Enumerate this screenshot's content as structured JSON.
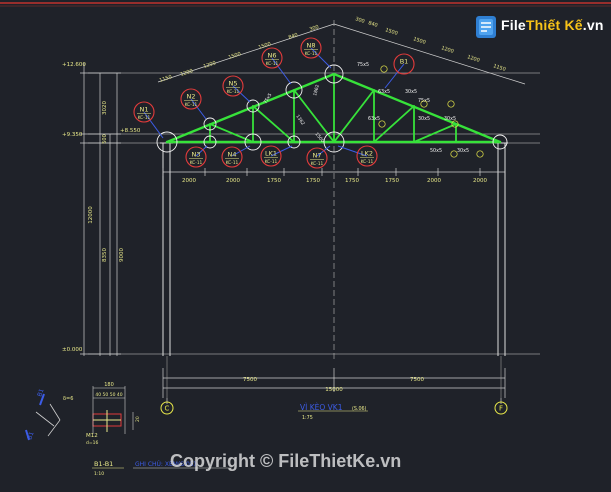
{
  "colors": {
    "background": "#1f2229",
    "truss": "#37e23a",
    "grid": "#bfbfbf",
    "dim_text": "#e9e98a",
    "node_circle": "#e13b3b",
    "node_marker": "#ffffff",
    "member_tag": "#3c5ce6",
    "axis_bubble": "#e8e84a",
    "border": "#c0322e"
  },
  "watermark": {
    "logo_part1": "File",
    "logo_part2": "Thiết Kế",
    "logo_part3": ".vn",
    "footer": "Copyright © FileThietKe.vn"
  },
  "top_dims": {
    "left": [
      "1150",
      "1200",
      "1200",
      "1500",
      "1500",
      "840",
      "300"
    ],
    "right": [
      "300",
      "840",
      "1500",
      "1500",
      "1200",
      "1200",
      "1150"
    ]
  },
  "levels": {
    "top": "+12.600",
    "truss_bottom": "+9.350",
    "bearing": "+8.550",
    "ground": "±0.000"
  },
  "left_dims": [
    "3020",
    "500",
    "12000",
    "8350",
    "9000"
  ],
  "bottom_panels": [
    "2000",
    "2000",
    "1750",
    "1750",
    "1750",
    "1750",
    "2000",
    "2000"
  ],
  "spans": {
    "left": "7500",
    "right": "7500",
    "total": "15000"
  },
  "axes": {
    "left": "C",
    "right": "F"
  },
  "nodes": [
    {
      "name": "N1",
      "code": "KC-11"
    },
    {
      "name": "N2",
      "code": "KC-11"
    },
    {
      "name": "N5",
      "code": "KC-11"
    },
    {
      "name": "N6",
      "code": "KC-11"
    },
    {
      "name": "N8",
      "code": "KC-11"
    },
    {
      "name": "B1",
      "code": ""
    },
    {
      "name": "N3",
      "code": "KC-11"
    },
    {
      "name": "N4",
      "code": "KC-11"
    },
    {
      "name": "LK1",
      "code": "KC-11"
    },
    {
      "name": "N7",
      "code": "KC-11"
    },
    {
      "name": "LK2",
      "code": "KC-11"
    }
  ],
  "member_tags": {
    "top_right": [
      "75x5",
      "75x5",
      "63x5",
      "30x5",
      "30x5"
    ],
    "web": [
      "63x5",
      "30x5"
    ],
    "bottom_right": [
      "50x5",
      "30x5"
    ],
    "diagonal": [
      "75x5",
      "1862",
      "1362",
      "1500"
    ]
  },
  "truss_title": "VÌ KÈO VK1",
  "truss_title_note": "(S.06)",
  "truss_scale": "1:75",
  "detail": {
    "label_b1": "B1",
    "dim_top": "180",
    "dim_row": "40 50 50 40",
    "dim_side": "20",
    "bolt": "M12",
    "bolt_d": "d=16",
    "thickness": "δ=6",
    "section_title": "B1-B1",
    "section_scale": "1:10",
    "note": "GHI CHÚ: XEM(S.05)"
  }
}
